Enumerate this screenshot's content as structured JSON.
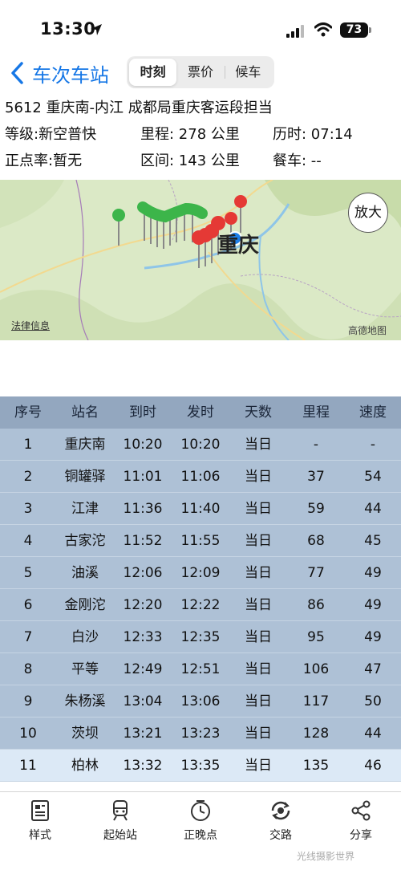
{
  "status_bar": {
    "time": "13:30",
    "battery": "73"
  },
  "nav": {
    "back_title": "车次车站",
    "tabs": [
      {
        "label": "时刻",
        "active": true
      },
      {
        "label": "票价",
        "active": false
      },
      {
        "label": "候车",
        "active": false
      }
    ]
  },
  "train_info": {
    "line1": "5612  重庆南-内江 成都局重庆客运段担当",
    "grade": "等级:新空普快",
    "distance": "里程: 278 公里",
    "duration": "历时: 07:14",
    "punctuality": "正点率:暂无",
    "section": "区间: 143 公里",
    "dining": "餐车: --"
  },
  "map": {
    "city_label": "重庆",
    "zoom_label": "放大",
    "legal_label": "法律信息",
    "brand_label": "高德地图",
    "colors": {
      "land": "#dbe9c6",
      "passed": "#3cb54a",
      "upcoming": "#e53935",
      "current": "#1e7fe8"
    }
  },
  "table": {
    "headers": [
      "序号",
      "站名",
      "到时",
      "发时",
      "天数",
      "里程",
      "速度"
    ],
    "rows": [
      [
        "1",
        "重庆南",
        "10:20",
        "10:20",
        "当日",
        "-",
        "-"
      ],
      [
        "2",
        "铜罐驿",
        "11:01",
        "11:06",
        "当日",
        "37",
        "54"
      ],
      [
        "3",
        "江津",
        "11:36",
        "11:40",
        "当日",
        "59",
        "44"
      ],
      [
        "4",
        "古家沱",
        "11:52",
        "11:55",
        "当日",
        "68",
        "45"
      ],
      [
        "5",
        "油溪",
        "12:06",
        "12:09",
        "当日",
        "77",
        "49"
      ],
      [
        "6",
        "金刚沱",
        "12:20",
        "12:22",
        "当日",
        "86",
        "49"
      ],
      [
        "7",
        "白沙",
        "12:33",
        "12:35",
        "当日",
        "95",
        "49"
      ],
      [
        "8",
        "平等",
        "12:49",
        "12:51",
        "当日",
        "106",
        "47"
      ],
      [
        "9",
        "朱杨溪",
        "13:04",
        "13:06",
        "当日",
        "117",
        "50"
      ],
      [
        "10",
        "茨坝",
        "13:21",
        "13:23",
        "当日",
        "128",
        "44"
      ],
      [
        "11",
        "柏林",
        "13:32",
        "13:35",
        "当日",
        "135",
        "46"
      ]
    ],
    "current_row_index": 10
  },
  "toolbar": {
    "items": [
      {
        "label": "样式",
        "icon": "style-icon"
      },
      {
        "label": "起始站",
        "icon": "train-icon"
      },
      {
        "label": "正晚点",
        "icon": "clock-icon"
      },
      {
        "label": "交路",
        "icon": "route-icon"
      },
      {
        "label": "分享",
        "icon": "share-icon"
      }
    ]
  },
  "watermark": "光线摄影世界"
}
